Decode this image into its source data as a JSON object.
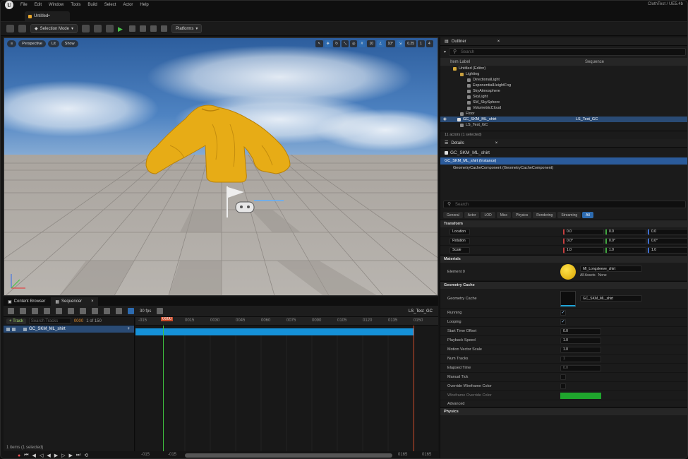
{
  "menubar": {
    "items": [
      "File",
      "Edit",
      "Window",
      "Tools",
      "Build",
      "Select",
      "Actor",
      "Help"
    ],
    "right_text": "ClothTest / UE5.4b"
  },
  "doc_tab": {
    "title": "Untitled•"
  },
  "toolbar": {
    "selection_mode": "Selection Mode",
    "platforms": "Platforms"
  },
  "viewport": {
    "perspective": "Perspective",
    "lit": "Lit",
    "show": "Show",
    "snap_value": "0.25",
    "cam_speed": "1",
    "grid": "10",
    "angle": "10°",
    "tab_marker": "4"
  },
  "outliner": {
    "title": "Outliner",
    "search_placeholder": "Search",
    "col_label": "Item Label",
    "col_type": "Sequence",
    "rows": [
      {
        "label": "Untitled (Editor)",
        "type": ""
      },
      {
        "label": "Lighting",
        "type": ""
      },
      {
        "label": "DirectionalLight",
        "type": ""
      },
      {
        "label": "ExponentialHeightFog",
        "type": ""
      },
      {
        "label": "SkyAtmosphere",
        "type": ""
      },
      {
        "label": "SkyLight",
        "type": ""
      },
      {
        "label": "SM_SkySphere",
        "type": ""
      },
      {
        "label": "VolumetricCloud",
        "type": ""
      },
      {
        "label": "Floor",
        "type": ""
      },
      {
        "label": "GC_SKM_ML_shirt",
        "type": "LS_Test_GC"
      },
      {
        "label": "LS_Test_GC",
        "type": ""
      }
    ],
    "status": "11 actors (1 selected)"
  },
  "details": {
    "title": "Details",
    "object": "GC_SKM_ML_shirt",
    "instance": "GC_SKM_ML_shirt (Instance)",
    "component": "GeometryCacheComponent (GeometryCacheComponent)",
    "search_placeholder": "Search",
    "tabs": [
      "General",
      "Actor",
      "LOD",
      "Misc",
      "Physics",
      "Rendering",
      "Streaming",
      "All"
    ],
    "transform": {
      "section": "Transform",
      "location": "Location",
      "rotation": "Rotation",
      "scale": "Scale",
      "loc": [
        "0.0",
        "0.0",
        "0.0"
      ],
      "rot": [
        "0.0°",
        "0.0°",
        "0.0°"
      ],
      "scl": [
        "1.0",
        "1.0",
        "1.0"
      ]
    },
    "materials": {
      "section": "Materials",
      "element": "Element 0",
      "material": "MI_Longsleeve_shirt",
      "all_assets": "All Assets",
      "none": "None"
    },
    "geometry_cache": {
      "section": "Geometry Cache",
      "label": "Geometry Cache",
      "asset": "GC_SKM_ML_shirt",
      "props": [
        {
          "label": "Running",
          "value": "✓"
        },
        {
          "label": "Looping",
          "value": "✓"
        },
        {
          "label": "Start Time Offset",
          "value": "0.0"
        },
        {
          "label": "Playback Speed",
          "value": "1.0"
        },
        {
          "label": "Motion Vector Scale",
          "value": "1.0"
        },
        {
          "label": "Num Tracks",
          "value": "1"
        },
        {
          "label": "Elapsed Time",
          "value": "0.0"
        },
        {
          "label": "Manual Tick",
          "value": ""
        },
        {
          "label": "Override Wireframe Color",
          "value": ""
        },
        {
          "label": "Wireframe Override Color",
          "value": ""
        }
      ]
    },
    "advanced": "Advanced",
    "physics": "Physics"
  },
  "bottom": {
    "tab_content": "Content Browser",
    "tab_sequencer": "Sequencer",
    "fps": "30 fps",
    "sequence_name": "LS_Test_GC",
    "track_btn": "+ Track",
    "search_tracks": "Search Tracks",
    "frame": "0000",
    "frame_of": "1 of 150",
    "track_name": "GC_SKM_ML_shirt",
    "status": "1 items (1 selected)",
    "start": "-015",
    "end": "0165",
    "ruler_ticks": [
      "-015",
      "0000",
      "0015",
      "0030",
      "0045",
      "0060",
      "0075",
      "0090",
      "0105",
      "0120",
      "0135",
      "0150"
    ],
    "scroll_left": "-015",
    "scroll_in": "-015",
    "scroll_out": "0165",
    "scroll_right": "0165"
  },
  "colors": {
    "accent": "#2d6bb0",
    "timeline_bar": "#1591d8",
    "shirt": "#e7ac16",
    "wireframe": "#1fa52d"
  }
}
